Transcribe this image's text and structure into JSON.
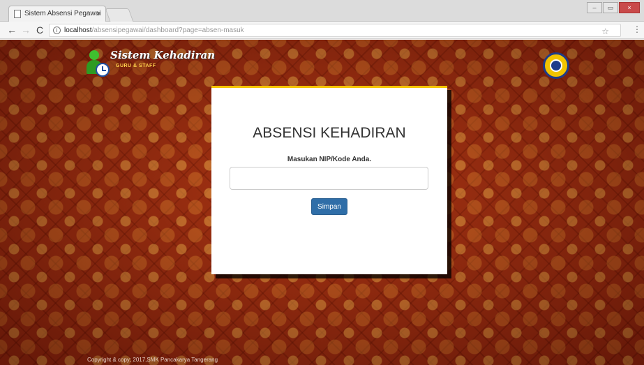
{
  "browser": {
    "tab_title": "Sistem Absensi Pegawai",
    "tab_close": "×",
    "url_host": "localhost",
    "url_path": "/absensipegawai/dashboard?page=absen-masuk",
    "nav_back": "←",
    "nav_forward": "→",
    "nav_reload": "C",
    "info": "i",
    "star": "☆",
    "menu": "⋮",
    "win_minimize": "‒",
    "win_restore": "▭",
    "win_close": "×"
  },
  "header": {
    "logo_title": "Sistem Kehadiran",
    "logo_subtitle": "GURU & STAFF"
  },
  "card": {
    "title": "ABSENSI KEHADIRAN",
    "label": "Masukan NIP/Kode Anda.",
    "input_value": "",
    "button": "Simpan"
  },
  "footer": {
    "copyright": "Copyright & copy; 2017,SMK Pancakarya Tangerang"
  },
  "colors": {
    "background": "#9c2a10",
    "card_accent": "#f5c600",
    "button": "#2f6ea8"
  }
}
